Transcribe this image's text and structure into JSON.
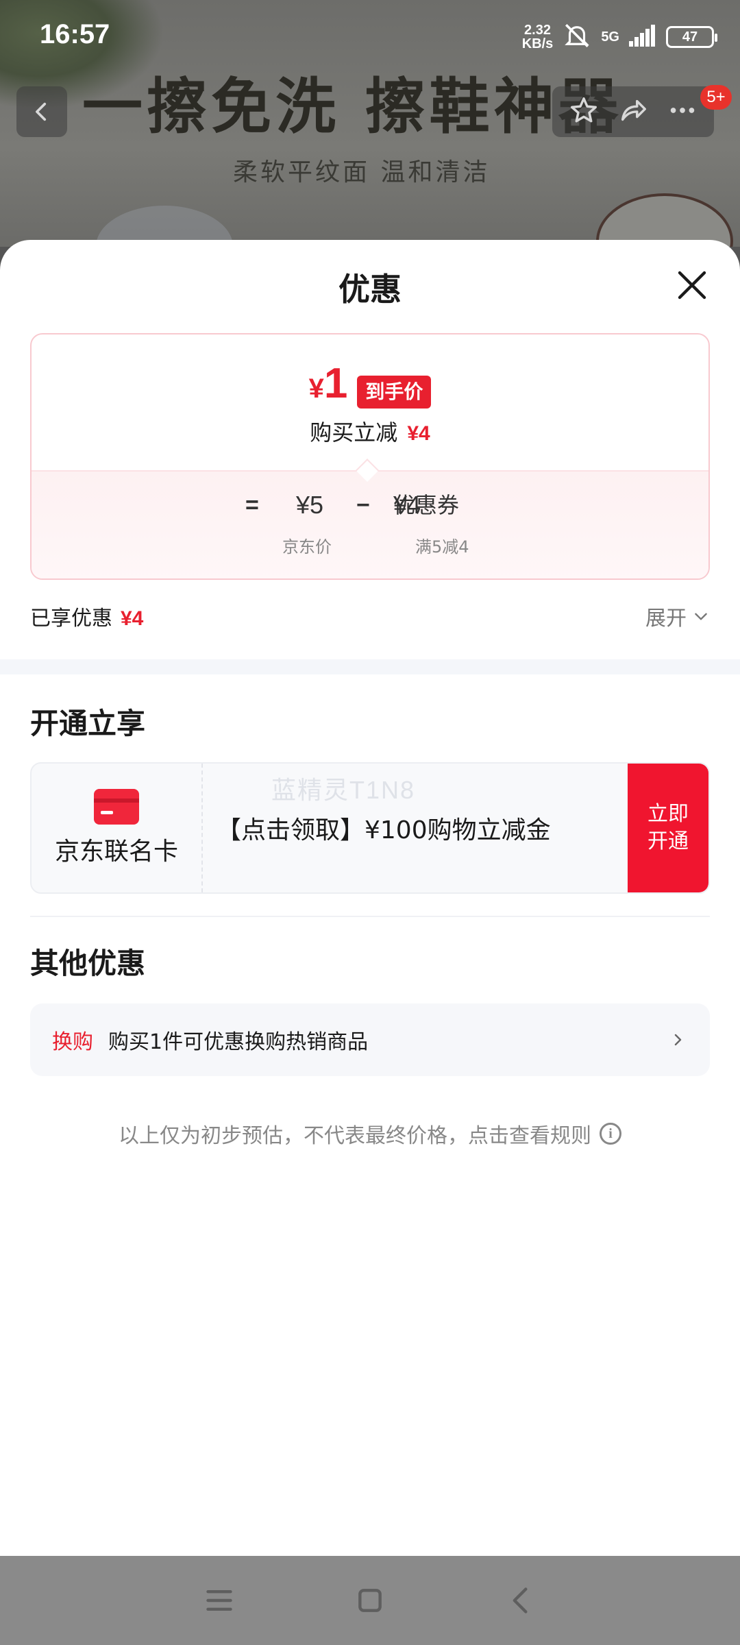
{
  "status_bar": {
    "time": "16:57",
    "net_speed_value": "2.32",
    "net_speed_unit": "KB/s",
    "signal_label": "5G",
    "battery": "47"
  },
  "background_page": {
    "headline": "一擦免洗 擦鞋神器",
    "subheadline": "柔软平纹面 温和清洁",
    "cart_badge": "5+"
  },
  "sheet": {
    "title": "优惠",
    "final_price": {
      "currency": "¥",
      "amount": "1",
      "tag": "到手价",
      "reduce_label": "购买立减",
      "reduce_amount": "¥4"
    },
    "breakdown": {
      "equals": "=",
      "jd_price": "¥5",
      "minus": "−",
      "coupon_label": "优惠券",
      "coupon_amount": "¥4",
      "jd_price_label": "京东价",
      "coupon_condition": "满5减4"
    },
    "enjoyed": {
      "label": "已享优惠",
      "amount": "¥4",
      "expand_label": "展开"
    },
    "open_section": {
      "title": "开通立享",
      "card_name": "京东联名卡",
      "offer_text": "【点击领取】¥100购物立减金",
      "watermark": "蓝精灵T1N8",
      "button_line1": "立即",
      "button_line2": "开通"
    },
    "other_section": {
      "title": "其他优惠",
      "trade_tag": "换购",
      "trade_text": "购买1件可优惠换购热销商品"
    },
    "disclaimer": "以上仅为初步预估，不代表最终价格，点击查看规则"
  },
  "colors": {
    "accent_red": "#e8202f",
    "button_red": "#f0152f"
  },
  "icons": {
    "close": "close-icon",
    "expand": "chevron-down-icon",
    "trade_arrow": "chevron-right-icon",
    "info": "info-icon",
    "card": "credit-card-icon"
  }
}
